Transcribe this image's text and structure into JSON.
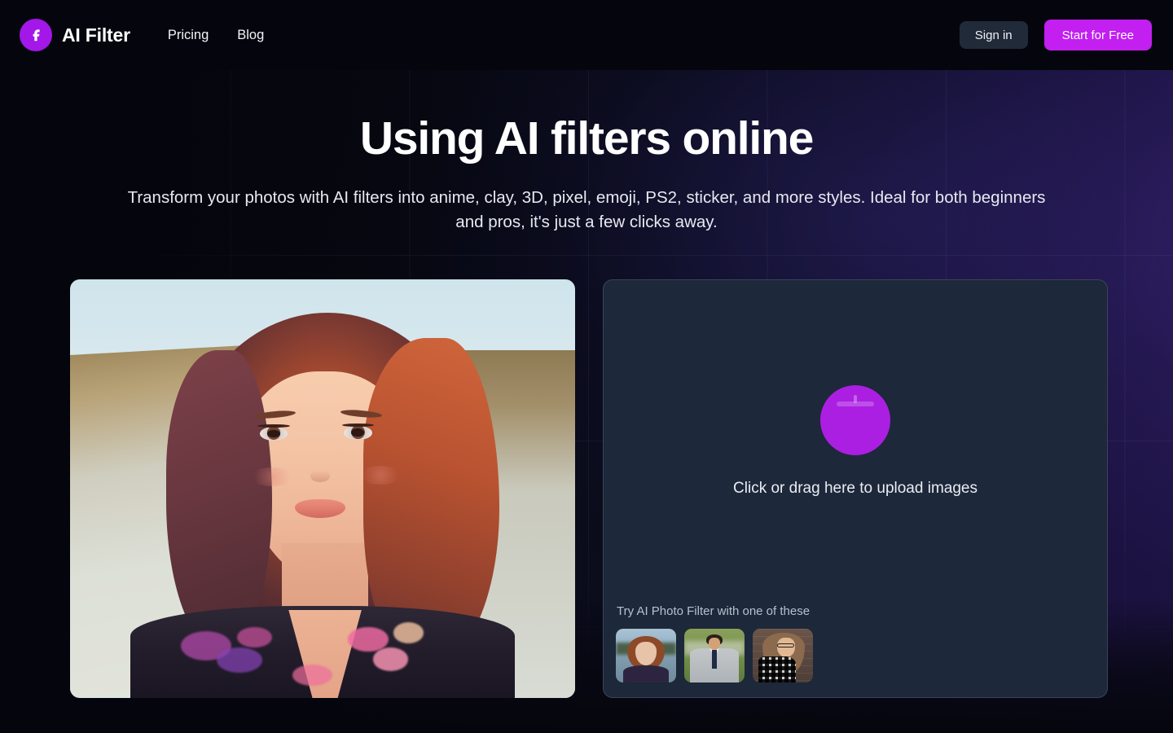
{
  "header": {
    "logo_icon": "letter-f-logo-icon",
    "brand": "AI Filter",
    "nav": [
      {
        "label": "Pricing"
      },
      {
        "label": "Blog"
      }
    ],
    "signin_label": "Sign in",
    "cta_label": "Start for Free",
    "colors": {
      "brand_purple": "#a317e8",
      "cta_purple": "#c21ff0",
      "signin_bg": "#212a38",
      "page_bg": "#05060d"
    }
  },
  "hero": {
    "title": "Using AI filters online",
    "subtitle": "Transform your photos with AI filters into anime, clay, 3D, pixel, emoji, PS2, sticker, and more styles. Ideal for both beginners and pros, it's just a few clicks away."
  },
  "preview": {
    "alt": "anime-style illustration of a young woman with an auburn bob in front of a weathered concrete wall"
  },
  "uploader": {
    "upload_icon": "upload-cloud-icon",
    "drop_text": "Click or drag here to upload images",
    "samples_label": "Try AI Photo Filter with one of these",
    "samples": [
      {
        "name": "sample-thumbnail-1",
        "alt": "woman with auburn bob in front of a lake"
      },
      {
        "name": "sample-thumbnail-2",
        "alt": "man in a grey suit with navy tie outdoors"
      },
      {
        "name": "sample-thumbnail-3",
        "alt": "woman with glasses and plaid scarf by a brick wall"
      }
    ],
    "colors": {
      "panel_bg": "#1d283a",
      "panel_border": "#3a4559",
      "badge_purple": "#ab1fe2"
    }
  }
}
